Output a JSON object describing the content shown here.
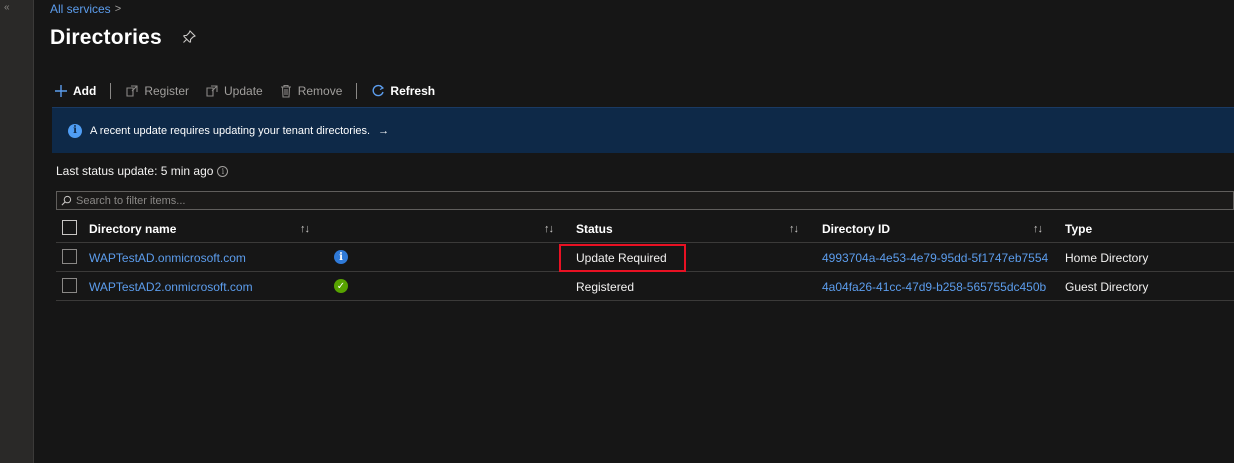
{
  "breadcrumb": {
    "link": "All services",
    "separator": ">"
  },
  "page": {
    "title": "Directories"
  },
  "toolbar": {
    "add": "Add",
    "register": "Register",
    "update": "Update",
    "remove": "Remove",
    "refresh": "Refresh"
  },
  "banner": {
    "text": "A recent update requires updating your tenant directories.",
    "arrow": "→"
  },
  "status": {
    "text": "Last status update: 5 min ago"
  },
  "filter": {
    "placeholder": "Search to filter items..."
  },
  "table": {
    "headers": {
      "name": "Directory name",
      "status": "Status",
      "id": "Directory ID",
      "type": "Type",
      "sort": "↑↓"
    },
    "rows": [
      {
        "name": "WAPTestAD.onmicrosoft.com",
        "status": "Update Required",
        "id": "4993704a-4e53-4e79-95dd-5f1747eb7554",
        "type": "Home Directory",
        "icon": "info-icon"
      },
      {
        "name": "WAPTestAD2.onmicrosoft.com",
        "status": "Registered",
        "id": "4a04fa26-41cc-47d9-b258-565755dc450b",
        "type": "Guest Directory",
        "icon": "check-icon"
      }
    ]
  },
  "colors": {
    "link": "#5c9ded",
    "banner": "#0e2948",
    "highlight": "#e81123",
    "ok": "#57a300",
    "info": "#2f7ad8"
  }
}
